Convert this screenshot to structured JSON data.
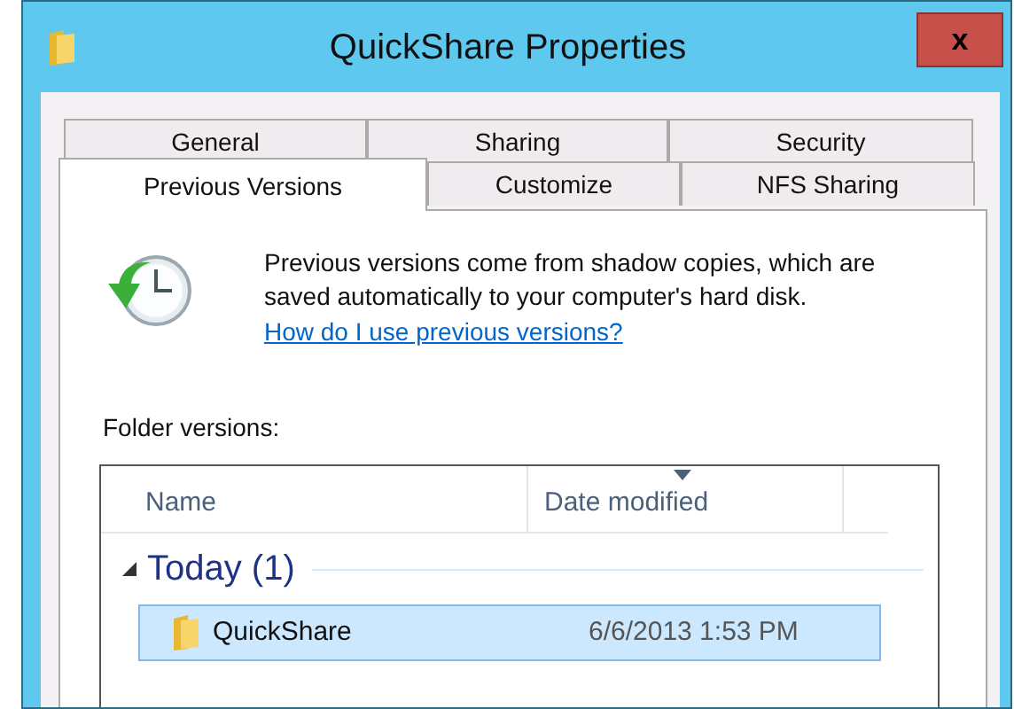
{
  "window": {
    "title": "QuickShare Properties",
    "close": "x"
  },
  "tab_rows": [
    [
      {
        "label": "General",
        "selected": false
      },
      {
        "label": "Sharing",
        "selected": false
      },
      {
        "label": "Security",
        "selected": false
      }
    ],
    [
      {
        "label": "Previous Versions",
        "selected": true
      },
      {
        "label": "Customize",
        "selected": false
      },
      {
        "label": "NFS Sharing",
        "selected": false
      }
    ]
  ],
  "info": {
    "text": "Previous versions come from shadow copies, which are saved automatically to your computer's hard disk.",
    "link": "How do I use previous versions?"
  },
  "versions": {
    "label": "Folder versions:",
    "columns": [
      {
        "label": "Name",
        "sorted": false
      },
      {
        "label": "Date modified",
        "sorted": true
      }
    ],
    "groups": [
      {
        "label": "Today (1)",
        "expanded": true,
        "rows": [
          {
            "name": "QuickShare",
            "date": "6/6/2013 1:53 PM",
            "selected": true
          }
        ]
      }
    ]
  }
}
